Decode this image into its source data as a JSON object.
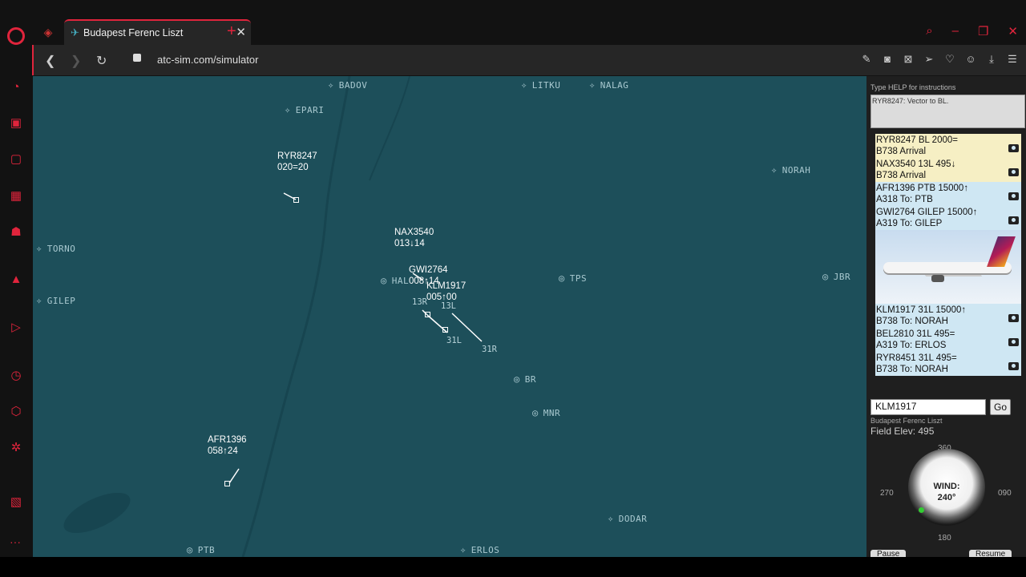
{
  "browser": {
    "tab_title": "Budapest Ferenc Liszt",
    "url": "atc-sim.com/simulator"
  },
  "radar": {
    "fixes": [
      {
        "name": "BADOV",
        "type": "fix"
      },
      {
        "name": "LITKU",
        "type": "fix"
      },
      {
        "name": "NALAG",
        "type": "fix"
      },
      {
        "name": "EPARI",
        "type": "fix"
      },
      {
        "name": "NORAH",
        "type": "fix"
      },
      {
        "name": "TORNO",
        "type": "fix"
      },
      {
        "name": "GILEP",
        "type": "fix"
      },
      {
        "name": "DODAR",
        "type": "fix"
      },
      {
        "name": "ERLOS",
        "type": "fix"
      },
      {
        "name": "TPS",
        "type": "vor"
      },
      {
        "name": "JBR",
        "type": "vor"
      },
      {
        "name": "BR",
        "type": "vor"
      },
      {
        "name": "MNR",
        "type": "vor"
      },
      {
        "name": "PTB",
        "type": "vor"
      },
      {
        "name": "HAL",
        "type": "vor"
      }
    ],
    "runways": [
      "13R",
      "13L",
      "31L",
      "31R"
    ],
    "aircraft": [
      {
        "callsign": "RYR8247",
        "data": "020=20"
      },
      {
        "callsign": "NAX3540",
        "data": "013↓14"
      },
      {
        "callsign": "GWI2764",
        "data": "008↑14"
      },
      {
        "callsign": "KLM1917",
        "data": "005↑00"
      },
      {
        "callsign": "AFR1396",
        "data": "058↑24"
      }
    ]
  },
  "panel": {
    "help_text": "Type HELP for instructions",
    "message": "RYR8247: Vector to BL.",
    "strips": [
      {
        "line1": "RYR8247  BL  2000=",
        "line2": "B738  Arrival",
        "kind": "arr"
      },
      {
        "line1": "NAX3540  13L  495↓",
        "line2": "B738  Arrival",
        "kind": "arr"
      },
      {
        "line1": "AFR1396  PTB  15000↑",
        "line2": "A318   To: PTB",
        "kind": "dep"
      },
      {
        "line1": "GWI2764  GILEP  15000↑",
        "line2": "A319   To: GILEP",
        "kind": "dep"
      },
      {
        "line1": "KLM1917  31L  15000↑",
        "line2": "B738   To: NORAH",
        "kind": "dep"
      },
      {
        "line1": "BEL2810  31L  495=",
        "line2": "A319   To: ERLOS",
        "kind": "dep"
      },
      {
        "line1": "RYR8451  31L  495=",
        "line2": "B738   To: NORAH",
        "kind": "dep"
      }
    ],
    "command_value": "KLM1917",
    "go_label": "Go",
    "airport_name": "Budapest Ferenc Liszt",
    "field_elev": "Field Elev: 495",
    "compass": {
      "n": "360",
      "e": "090",
      "s": "180",
      "w": "270"
    },
    "wind_label": "WIND:",
    "wind_value": "240°",
    "pause_label": "Pause",
    "resume_label": "Resume"
  },
  "colors": {
    "accent": "#e0243c",
    "radar_bg": "#1d4f5a",
    "arrival_strip": "#f6efc4",
    "departure_strip": "#cfe7f3"
  }
}
